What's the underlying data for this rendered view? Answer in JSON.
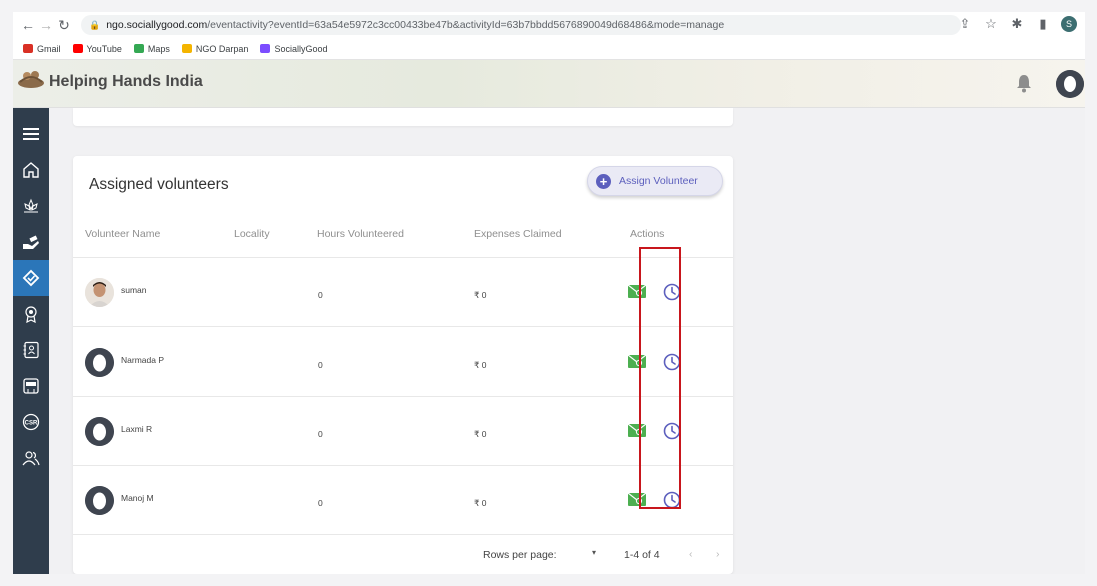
{
  "browser": {
    "url_host": "ngo.sociallygood.com",
    "url_path": "/eventactivity?eventId=63a54e5972c3cc00433be47b&activityId=63b7bbdd5676890049d68486&mode=manage",
    "profile_initial": "S",
    "bookmarks": [
      {
        "label": "Gmail",
        "color": "#d93025"
      },
      {
        "label": "YouTube",
        "color": "#ff0000"
      },
      {
        "label": "Maps",
        "color": "#34a853"
      },
      {
        "label": "NGO Darpan",
        "color": "#f4b400"
      },
      {
        "label": "SociallyGood",
        "color": "#7c4dff"
      }
    ]
  },
  "header": {
    "org_name": "Helping Hands India"
  },
  "sidebar": {
    "items": [
      {
        "icon": "menu-icon"
      },
      {
        "icon": "home-icon"
      },
      {
        "icon": "lotus-icon"
      },
      {
        "icon": "donation-hand-icon"
      },
      {
        "icon": "volunteer-activity-icon",
        "active": true
      },
      {
        "icon": "badge-icon"
      },
      {
        "icon": "contacts-book-icon"
      },
      {
        "icon": "ngo-icon"
      },
      {
        "icon": "csr-icon"
      },
      {
        "icon": "users-icon"
      }
    ]
  },
  "volunteers": {
    "title": "Assigned volunteers",
    "assign_button": "Assign Volunteer",
    "columns": [
      "Volunteer Name",
      "Locality",
      "Hours Volunteered",
      "Expenses Claimed",
      "Actions"
    ],
    "rows": [
      {
        "name": "suman",
        "locality": "",
        "hours": "0",
        "expenses": "₹ 0",
        "avatar": "photo"
      },
      {
        "name": "Narmada P",
        "locality": "",
        "hours": "0",
        "expenses": "₹ 0",
        "avatar": "default"
      },
      {
        "name": "Laxmi R",
        "locality": "",
        "hours": "0",
        "expenses": "₹ 0",
        "avatar": "default"
      },
      {
        "name": "Manoj M",
        "locality": "",
        "hours": "0",
        "expenses": "₹ 0",
        "avatar": "default"
      }
    ],
    "pagination": {
      "rows_per_page_label": "Rows per page:",
      "range": "1-4 of 4"
    }
  },
  "colors": {
    "sidebar_bg": "#2f3d4c",
    "sidebar_active": "#2b76b9",
    "accent": "#5c5fbd",
    "mail_icon": "#4caf50",
    "highlight": "#c8161d"
  }
}
